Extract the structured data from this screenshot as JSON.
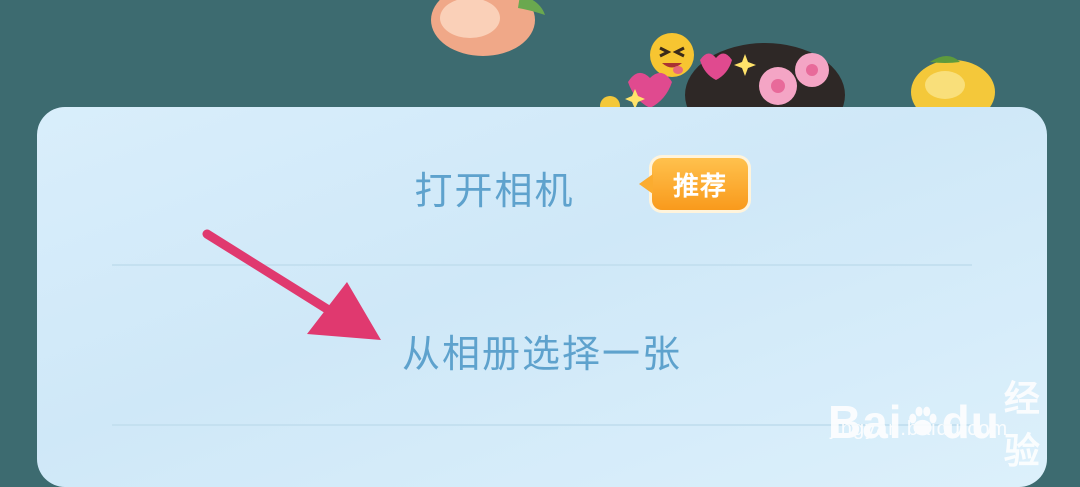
{
  "menu": {
    "camera_label": "打开相机",
    "recommend_badge": "推荐",
    "album_label": "从相册选择一张"
  },
  "watermark": {
    "logo_left": "Bai",
    "logo_right": "du",
    "logo_cn": "经验",
    "url": "jingyan.baidu.com"
  },
  "colors": {
    "backdrop": "#3d6b70",
    "sheet": "#d4ebf9",
    "option_text": "#5ea2cd",
    "badge": "#f9a228",
    "arrow": "#e0396f"
  }
}
